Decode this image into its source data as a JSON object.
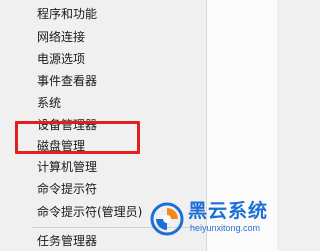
{
  "menu": {
    "items": [
      {
        "label": "程序和功能"
      },
      {
        "label": "网络连接"
      },
      {
        "label": "电源选项"
      },
      {
        "label": "事件查看器"
      },
      {
        "label": "系统"
      },
      {
        "label": "设备管理器"
      },
      {
        "label": "磁盘管理"
      },
      {
        "label": "计算机管理"
      },
      {
        "label": "命令提示符"
      },
      {
        "label": "命令提示符(管理员)"
      },
      {
        "label": "任务管理器"
      }
    ]
  },
  "watermark": {
    "brand": "黑云系统",
    "domain": "heiyunxitong.com"
  },
  "colors": {
    "highlight_border": "#e02020",
    "watermark_blue": "#1d6fd8",
    "watermark_orange": "#f08a1c"
  }
}
